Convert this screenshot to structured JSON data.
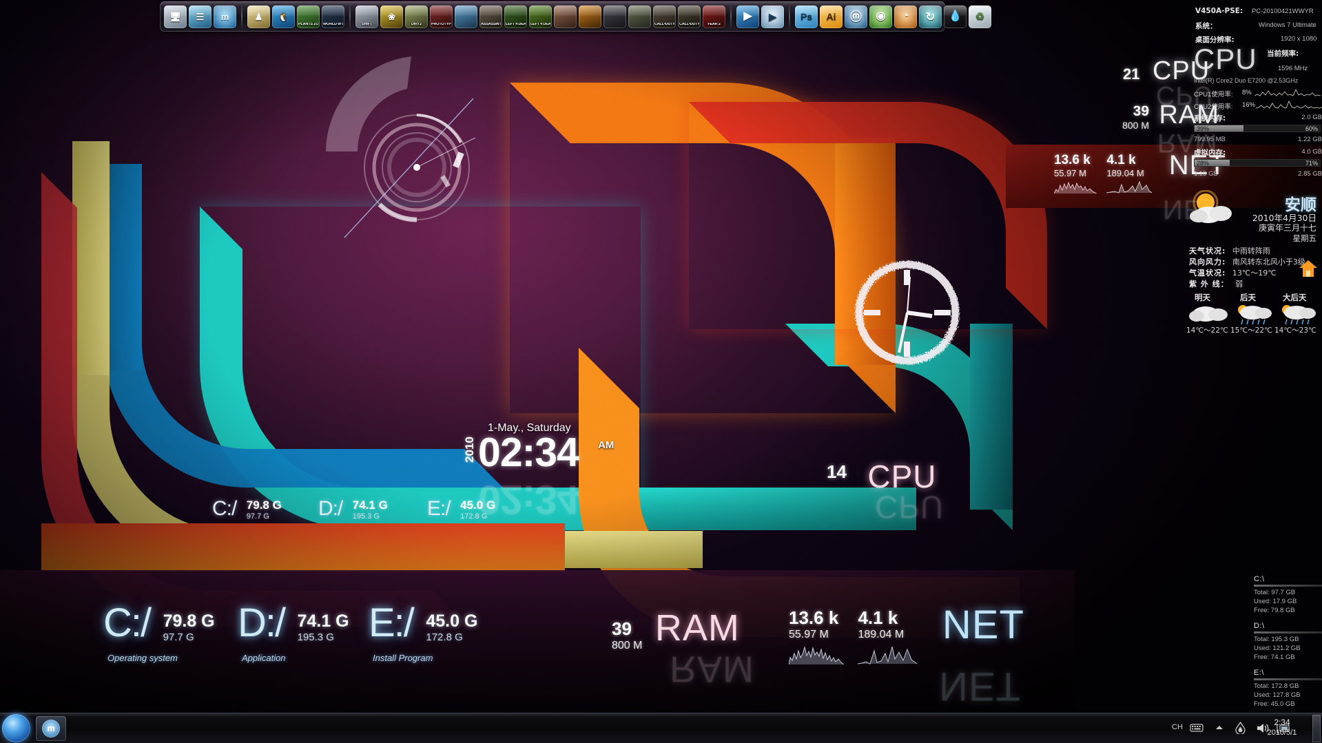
{
  "desktop": {
    "hud": {
      "name": "abstract-compass-hud"
    },
    "analog_clock": {
      "name": "grunge-analog-clock",
      "hour": 2,
      "minute": 34
    }
  },
  "dock": {
    "groups": [
      {
        "items": [
          {
            "name": "monitor-icon",
            "label": "",
            "color1": "#cfd8e0",
            "color2": "#6f7d8c",
            "glyph": "🖥"
          },
          {
            "name": "window-blinds-icon",
            "label": "",
            "color1": "#8fd3f0",
            "color2": "#1d5b82",
            "glyph": "☰"
          },
          {
            "name": "maxthon-browser-icon",
            "label": "",
            "color1": "#63c4f0",
            "color2": "#11558e",
            "glyph": "m"
          }
        ]
      },
      {
        "items": [
          {
            "name": "game-icon-penguin-yellow",
            "label": "",
            "color1": "#f3e3a8",
            "color2": "#7e6a2a",
            "glyph": "♟"
          },
          {
            "name": "game-icon-qq-penguin",
            "label": "",
            "color1": "#3fa9e8",
            "color2": "#0b3f70",
            "glyph": "🐧"
          },
          {
            "name": "game-icon-plants-vs-zombies",
            "label": "PLANTS ZOMBIES",
            "color1": "#4e8f3a",
            "color2": "#1d3d16",
            "glyph": ""
          },
          {
            "name": "game-icon-world-of-goo",
            "label": "WORLD of GOO",
            "color1": "#2b3f5a",
            "color2": "#0c141f",
            "glyph": ""
          }
        ]
      },
      {
        "items": [
          {
            "name": "game-icon-racing-white",
            "label": "SHIFT",
            "color1": "#b9c2cc",
            "color2": "#42484f",
            "glyph": ""
          },
          {
            "name": "game-icon-yellow-flower",
            "label": "",
            "color1": "#e3c23a",
            "color2": "#4a3b08",
            "glyph": "❀"
          },
          {
            "name": "game-icon-dirt-2",
            "label": "DiRT2",
            "color1": "#9fa86a",
            "color2": "#2f3318",
            "glyph": ""
          },
          {
            "name": "game-icon-prototype",
            "label": "PROTOTYPE",
            "color1": "#8a2b2b",
            "color2": "#2a0a0a",
            "glyph": ""
          },
          {
            "name": "game-icon-blue-fantasy",
            "label": "",
            "color1": "#5e9ec9",
            "color2": "#16324a",
            "glyph": ""
          },
          {
            "name": "game-icon-assassins-creed",
            "label": "ASSASSIN'S",
            "color1": "#6e6352",
            "color2": "#201c15",
            "glyph": ""
          },
          {
            "name": "game-icon-left-4-dead",
            "label": "LEFT 4 DEAD",
            "color1": "#3f6b24",
            "color2": "#10200a",
            "glyph": ""
          },
          {
            "name": "game-icon-left-4-dead-2",
            "label": "LEFT 4 DEAD 2",
            "color1": "#5d8a26",
            "color2": "#18260a",
            "glyph": ""
          },
          {
            "name": "game-icon-portrait-woman",
            "label": "",
            "color1": "#9c6d55",
            "color2": "#2e1c14",
            "glyph": ""
          },
          {
            "name": "game-icon-orange-action",
            "label": "",
            "color1": "#d4821f",
            "color2": "#3b2206",
            "glyph": ""
          },
          {
            "name": "game-icon-dark-shooter",
            "label": "",
            "color1": "#4a4a52",
            "color2": "#121216",
            "glyph": ""
          },
          {
            "name": "game-icon-soldier",
            "label": "",
            "color1": "#6d7358",
            "color2": "#20231a",
            "glyph": ""
          },
          {
            "name": "game-icon-call-of-duty",
            "label": "CALL•DUTY",
            "color1": "#5a5142",
            "color2": "#1a1712",
            "glyph": ""
          },
          {
            "name": "game-icon-call-of-duty-2",
            "label": "CALL•DUTY",
            "color1": "#4e4736",
            "color2": "#16140e",
            "glyph": ""
          },
          {
            "name": "game-icon-fear-2",
            "label": "FEAR 2",
            "color1": "#8c1d1d",
            "color2": "#2a0707",
            "glyph": ""
          }
        ]
      },
      {
        "items": [
          {
            "name": "kmplayer-icon",
            "label": "",
            "color1": "#4aa3e0",
            "color2": "#0d3f72",
            "glyph": "▶"
          },
          {
            "name": "media-player-icon",
            "label": "",
            "color1": "#cfe6f5",
            "color2": "#5b87a8",
            "glyph": "▶"
          }
        ]
      },
      {
        "items": [
          {
            "name": "photoshop-icon",
            "label": "",
            "color1": "#6cc3f0",
            "color2": "#1a6fa8",
            "glyph": "Ps"
          },
          {
            "name": "illustrator-icon",
            "label": "",
            "color1": "#ffc246",
            "color2": "#b06d05",
            "glyph": "Ai"
          },
          {
            "name": "winamp-icon",
            "label": "",
            "color1": "#7fc8ef",
            "color2": "#1b4f7a",
            "glyph": "ⓜ"
          },
          {
            "name": "green-app-icon",
            "label": "",
            "color1": "#8ede55",
            "color2": "#256b14",
            "glyph": "◉"
          },
          {
            "name": "orange-app-icon",
            "label": "",
            "color1": "#ffb348",
            "color2": "#a24e05",
            "glyph": "◔"
          },
          {
            "name": "cycle-app-icon",
            "label": "",
            "color1": "#57cfd6",
            "color2": "#0c4a55",
            "glyph": "↻"
          }
        ]
      },
      {
        "items": [
          {
            "name": "water-drop-icon",
            "label": "",
            "color1": "#1a1a1e",
            "color2": "#0a0a0c",
            "glyph": "💧"
          },
          {
            "name": "recycle-bin-icon",
            "label": "",
            "color1": "#e8eef2",
            "color2": "#9aa6ae",
            "glyph": "♻"
          }
        ]
      }
    ]
  },
  "widgets": {
    "big_drives": [
      {
        "letter": "C:/",
        "free": "79.8 G",
        "total": "97.7 G",
        "caption": "Operating system"
      },
      {
        "letter": "D:/",
        "free": "74.1 G",
        "total": "195.3 G",
        "caption": "Application"
      },
      {
        "letter": "E:/",
        "free": "45.0 G",
        "total": "172.8 G",
        "caption": "Install Program"
      }
    ],
    "small_drives": [
      {
        "letter": "C:/",
        "free": "79.8 G",
        "total": "97.7 G"
      },
      {
        "letter": "D:/",
        "free": "74.1 G",
        "total": "195.3 G"
      },
      {
        "letter": "E:/",
        "free": "45.0 G",
        "total": "172.8 G"
      }
    ],
    "ram_bottom": {
      "label": "RAM",
      "percent": "39",
      "used": "800 M"
    },
    "net_bottom": {
      "label": "NET",
      "down_rate": "13.6 k",
      "up_rate": "4.1 k",
      "down_total": "55.97 M",
      "up_total": "189.04 M"
    },
    "cpu_center": {
      "label": "CPU",
      "percent": "14"
    },
    "cpu_top": {
      "label": "CPU",
      "percent": "21"
    },
    "ram_top": {
      "label": "RAM",
      "percent": "39",
      "used": "800 M"
    },
    "net_top": {
      "label": "NET",
      "down_rate": "13.6 k",
      "up_rate": "4.1 k",
      "down_total": "55.97 M",
      "up_total": "189.04 M"
    },
    "clock": {
      "date": "1-May., Saturday",
      "time": "02:34",
      "ampm": "AM",
      "year": "2010"
    }
  },
  "sysinfo": {
    "machine_label": "V450A-PSE:",
    "machine_value": "PC-20100421WWYR",
    "os_label": "系统：",
    "os_value": "Windows 7 Ultimate",
    "res_label": "桌面分辨率:",
    "res_value": "1920 x 1080",
    "cpu_wordmark": "CPU",
    "freq_label": "当前频率:",
    "freq_value": "1596 MHz",
    "cpu_model": "Intel(R) Core2 Duo E7200 @2.53GHz",
    "cpu1_label": "CPU1使用率:",
    "cpu1_value": "8%",
    "cpu2_label": "CPU2使用率:",
    "cpu2_value": "16%",
    "sysmem_label": "系统内存:",
    "sysmem_total": "2.0 GB",
    "sysmem_pct_left": "39%",
    "sysmem_pct_right": "60%",
    "sysmem_used": "799.95 MB",
    "sysmem_free": "1.22 GB",
    "vmem_label": "虚拟内存:",
    "vmem_total": "4.0 GB",
    "vmem_pct_left": "28%",
    "vmem_pct_right": "71%",
    "vmem_used": "1.15 GB",
    "vmem_free": "2.85 GB"
  },
  "weather": {
    "city": "安顺",
    "date_solar": "2010年4月30日",
    "date_lunar": "庚寅年三月十七",
    "weekday": "星期五",
    "cond_label": "天气状况:",
    "cond_value": "中雨转阵雨",
    "wind_label": "风向风力:",
    "wind_value": "南风转东北风小于3级",
    "temp_label": "气温状况:",
    "temp_value": "13℃～19℃",
    "uv_label": "紫 外 线：",
    "uv_value": "弱",
    "forecast": [
      {
        "day": "明天",
        "temp": "14℃～22℃",
        "icon": "cloudy-icon"
      },
      {
        "day": "后天",
        "temp": "15℃～22℃",
        "icon": "rain-icon"
      },
      {
        "day": "大后天",
        "temp": "14℃～23℃",
        "icon": "rain-icon"
      }
    ],
    "home_icon": "home-icon"
  },
  "drive_panel": [
    {
      "name": "C:\\",
      "total": "Total: 97.7 GB",
      "used": "Used: 17.9 GB",
      "free": "Free: 79.8 GB",
      "fill": 18
    },
    {
      "name": "D:\\",
      "total": "Total: 195.3 GB",
      "used": "Used: 121.2 GB",
      "free": "Free: 74.1 GB",
      "fill": 62
    },
    {
      "name": "E:\\",
      "total": "Total: 172.8 GB",
      "used": "Used: 127.8 GB",
      "free": "Free: 45.0 GB",
      "fill": 74
    }
  ],
  "taskbar": {
    "start_label": "",
    "buttons": [
      {
        "name": "taskbar-maxthon-button",
        "glyph": "m"
      }
    ],
    "tray": {
      "ime": "CH",
      "keyboard_icon": "keyboard-icon",
      "chevron_icon": "show-hidden-icons-icon",
      "drop_icon": "water-drop-tray-icon",
      "volume_icon": "volume-icon",
      "network_icon": "network-icon"
    },
    "clock_time": "2:34",
    "clock_date": "2010/5/1"
  }
}
